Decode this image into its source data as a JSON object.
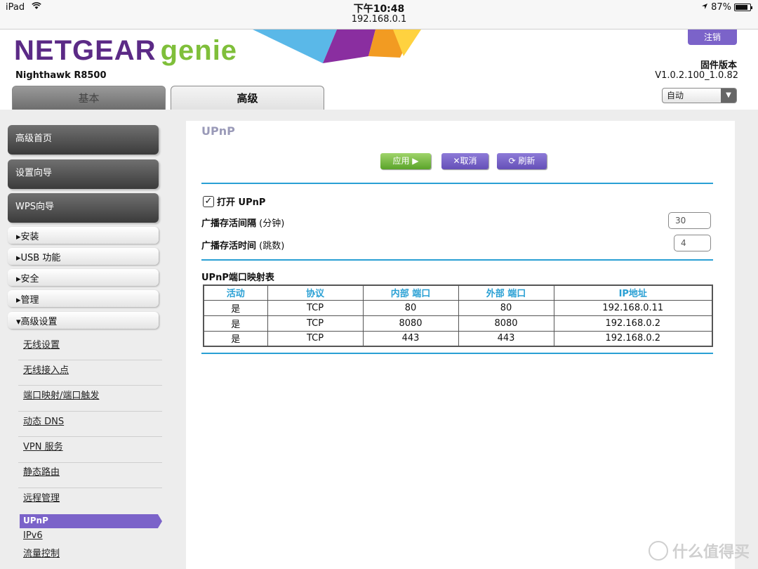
{
  "status_bar": {
    "device": "iPad",
    "time": "下午10:48",
    "url": "192.168.0.1",
    "battery": "87%",
    "battery_level": 0.87
  },
  "header": {
    "logo_brand": "NETGEAR",
    "logo_product": "genie",
    "model": "Nighthawk R8500",
    "logout_label": "注销",
    "firmware_title": "固件版本",
    "firmware_version": "V1.0.2.100_1.0.82",
    "language_selected": "自动",
    "tabs": [
      {
        "label": "基本",
        "active": false
      },
      {
        "label": "高级",
        "active": true
      }
    ]
  },
  "sidebar": {
    "main_buttons": [
      "高级首页",
      "设置向导",
      "WPS向导"
    ],
    "sections": [
      {
        "label": "▸安装"
      },
      {
        "label": "▸USB 功能"
      },
      {
        "label": "▸安全"
      },
      {
        "label": "▸管理"
      },
      {
        "label": "▾高级设置"
      }
    ],
    "sub_items": [
      "无线设置",
      "无线接入点",
      "端口映射/端口触发",
      "动态 DNS",
      "VPN 服务",
      "静态路由",
      "远程管理"
    ],
    "active_item": "UPnP",
    "after_items": [
      "IPv6",
      "流量控制"
    ]
  },
  "content": {
    "title": "UPnP",
    "buttons": {
      "apply": "应用 ▶",
      "cancel": "✕取消",
      "refresh": "⟳ 刷新"
    },
    "enable_label": "打开 UPnP",
    "enable_checked": true,
    "advertise_period_label": "广播存活间隔",
    "advertise_period_unit": "(分钟)",
    "advertise_period_value": "30",
    "advertise_ttl_label": "广播存活时间",
    "advertise_ttl_unit": "(跳数)",
    "advertise_ttl_value": "4",
    "table_title": "UPnP端口映射表",
    "table_headers": [
      "活动",
      "协议",
      "内部 端口",
      "外部 端口",
      "IP地址"
    ],
    "table_rows": [
      [
        "是",
        "TCP",
        "80",
        "80",
        "192.168.0.11"
      ],
      [
        "是",
        "TCP",
        "8080",
        "8080",
        "192.168.0.2"
      ],
      [
        "是",
        "TCP",
        "443",
        "443",
        "192.168.0.2"
      ]
    ]
  },
  "watermark": "什么值得买",
  "colors": {
    "brand_purple": "#5b2a86",
    "genie_green": "#7fbf3a",
    "accent_blue": "#2aa0d4",
    "button_purple": "#7b63c9"
  }
}
